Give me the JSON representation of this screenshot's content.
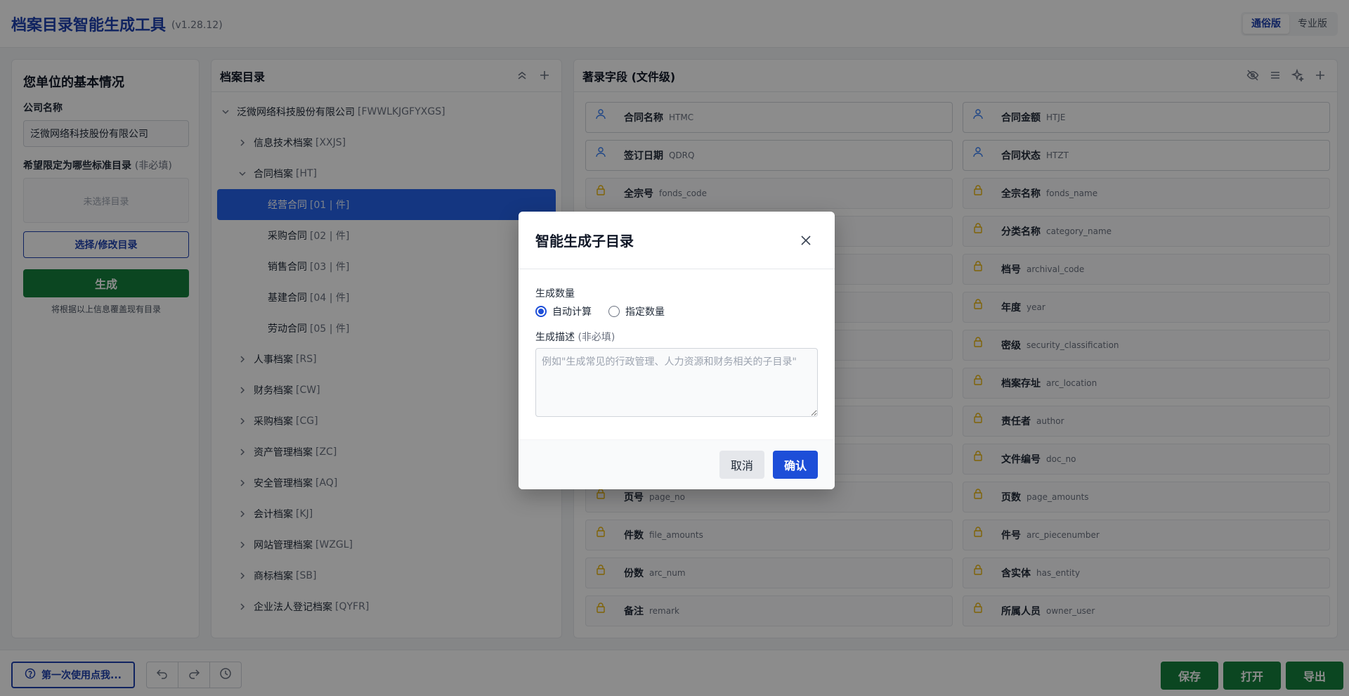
{
  "header": {
    "title": "档案目录智能生成工具",
    "version": "(v1.28.12)",
    "modes": [
      "通俗版",
      "专业版"
    ]
  },
  "left_panel": {
    "title": "您单位的基本情况",
    "company_label": "公司名称",
    "company_value": "泛微网络科技股份有限公司",
    "scope_label": "希望限定为哪些标准目录",
    "scope_optional": "(非必填)",
    "scope_empty": "未选择目录",
    "select_button": "选择/修改目录",
    "generate_button": "生成",
    "generate_hint": "将根据以上信息覆盖现有目录"
  },
  "mid_panel": {
    "title": "档案目录",
    "tree": [
      {
        "label": "泛微网络科技股份有限公司",
        "code": "[FWWLKJGFYXGS]"
      },
      {
        "label": "信息技术档案",
        "code": "[XXJS]"
      },
      {
        "label": "合同档案",
        "code": "[HT]"
      },
      {
        "label": "经营合同",
        "code": "[01 | 件]"
      },
      {
        "label": "采购合同",
        "code": "[02 | 件]"
      },
      {
        "label": "销售合同",
        "code": "[03 | 件]"
      },
      {
        "label": "基建合同",
        "code": "[04 | 件]"
      },
      {
        "label": "劳动合同",
        "code": "[05 | 件]"
      },
      {
        "label": "人事档案",
        "code": "[RS]"
      },
      {
        "label": "财务档案",
        "code": "[CW]"
      },
      {
        "label": "采购档案",
        "code": "[CG]"
      },
      {
        "label": "资产管理档案",
        "code": "[ZC]"
      },
      {
        "label": "安全管理档案",
        "code": "[AQ]"
      },
      {
        "label": "会计档案",
        "code": "[KJ]"
      },
      {
        "label": "网站管理档案",
        "code": "[WZGL]"
      },
      {
        "label": "商标档案",
        "code": "[SB]"
      },
      {
        "label": "企业法人登记档案",
        "code": "[QYFR]"
      }
    ]
  },
  "right_panel": {
    "title": "著录字段 (文件级)",
    "fields": [
      {
        "name": "合同名称",
        "code": "HTMC"
      },
      {
        "name": "合同金额",
        "code": "HTJE"
      },
      {
        "name": "签订日期",
        "code": "QDRQ"
      },
      {
        "name": "合同状态",
        "code": "HTZT"
      },
      {
        "name": "全宗号",
        "code": "fonds_code"
      },
      {
        "name": "全宗名称",
        "code": "fonds_name"
      },
      {
        "name": "",
        "code": ""
      },
      {
        "name": "分类名称",
        "code": "category_name"
      },
      {
        "name": "",
        "code": ""
      },
      {
        "name": "档号",
        "code": "archival_code"
      },
      {
        "name": "",
        "code": ""
      },
      {
        "name": "年度",
        "code": "year"
      },
      {
        "name": "",
        "code": ""
      },
      {
        "name": "密级",
        "code": "security_classification"
      },
      {
        "name": "",
        "code": ""
      },
      {
        "name": "档案存址",
        "code": "arc_location"
      },
      {
        "name": "",
        "code": ""
      },
      {
        "name": "责任者",
        "code": "author"
      },
      {
        "name": "",
        "code": ""
      },
      {
        "name": "文件编号",
        "code": "doc_no"
      },
      {
        "name": "页号",
        "code": "page_no"
      },
      {
        "name": "页数",
        "code": "page_amounts"
      },
      {
        "name": "件数",
        "code": "file_amounts"
      },
      {
        "name": "件号",
        "code": "arc_piecenumber"
      },
      {
        "name": "份数",
        "code": "arc_num"
      },
      {
        "name": "含实体",
        "code": "has_entity"
      },
      {
        "name": "备注",
        "code": "remark"
      },
      {
        "name": "所属人员",
        "code": "owner_user"
      }
    ]
  },
  "bottom": {
    "help": "第一次使用点我...",
    "save": "保存",
    "open": "打开",
    "export": "导出"
  },
  "dialog": {
    "title": "智能生成子目录",
    "count_label": "生成数量",
    "radio_auto": "自动计算",
    "radio_manual": "指定数量",
    "desc_label": "生成描述",
    "desc_optional": "(非必填)",
    "desc_placeholder": "例如\"生成常见的行政管理、人力资源和财务相关的子目录\"",
    "cancel": "取消",
    "confirm": "确认"
  },
  "colors": {
    "brand_blue": "#1e40af",
    "selected_blue": "#2563eb",
    "green": "#15803d",
    "lock_yellow": "#eab308",
    "user_blue": "#3b82f6"
  }
}
